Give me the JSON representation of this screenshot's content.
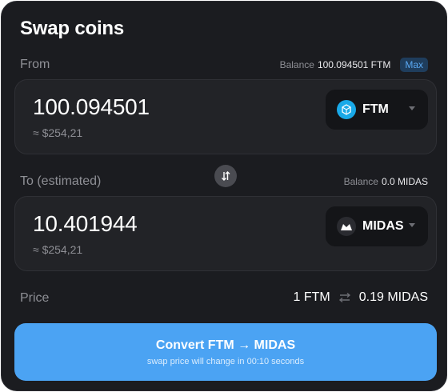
{
  "title": "Swap coins",
  "from": {
    "label": "From",
    "balance_prefix": "Balance",
    "balance_value": "100.094501 FTM",
    "max_label": "Max",
    "amount": "100.094501",
    "usd": "≈ $254,21",
    "token": "FTM",
    "token_icon": "fantom-icon"
  },
  "to": {
    "label": "To (estimated)",
    "balance_prefix": "Balance",
    "balance_value": "0.0 MIDAS",
    "amount": "10.401944",
    "usd": "≈ $254,21",
    "token": "MIDAS",
    "token_icon": "midas-icon"
  },
  "price": {
    "label": "Price",
    "left": "1 FTM",
    "right": "0.19 MIDAS"
  },
  "convert": {
    "label": "Convert FTM → MIDAS",
    "sub": "swap price will change in 00:10 seconds"
  },
  "colors": {
    "background": "#1b1c20",
    "accent": "#4ba3f3",
    "ftm": "#19a9e8"
  }
}
